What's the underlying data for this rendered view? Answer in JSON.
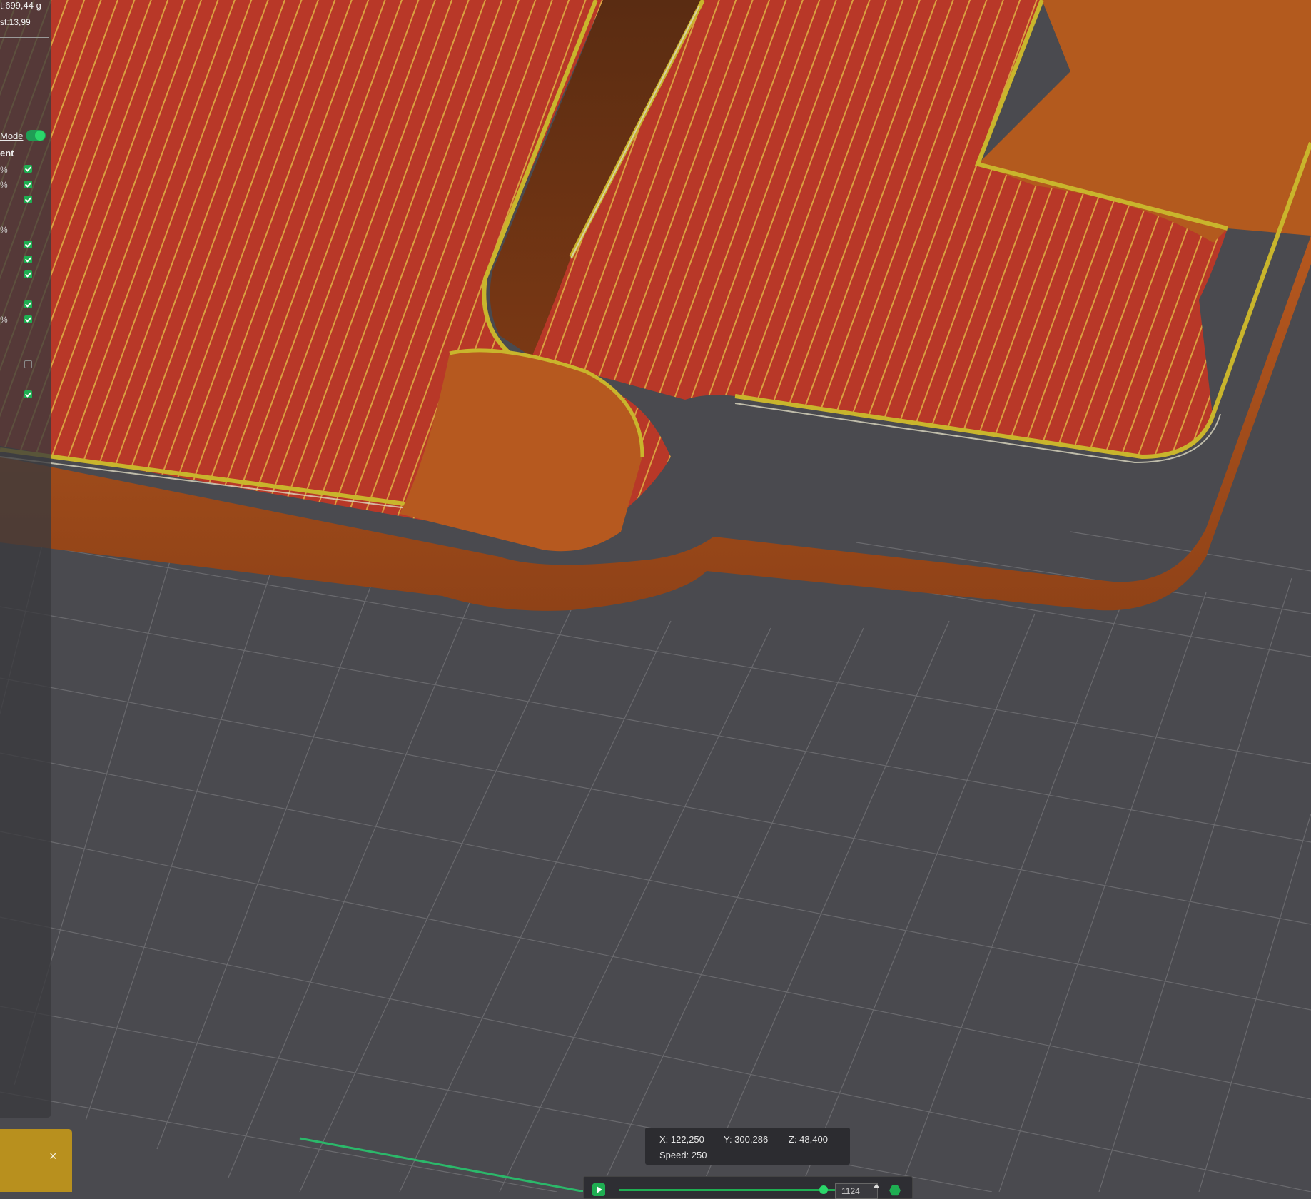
{
  "stats": {
    "weight": "t:699,44 g",
    "cost": "st:13,99"
  },
  "panel": {
    "mode_label": "Mode",
    "mode_enabled": true,
    "header": "ent",
    "rows": [
      {
        "pct": "%",
        "checked": true
      },
      {
        "pct": "%",
        "checked": true
      },
      {
        "pct": "",
        "checked": true
      },
      {
        "pct": "%",
        "checked": null
      },
      {
        "pct": "",
        "checked": true
      },
      {
        "pct": "",
        "checked": true
      },
      {
        "pct": "",
        "checked": true
      },
      {
        "pct": "",
        "checked": true
      },
      {
        "pct": "%",
        "checked": true
      },
      {
        "pct": "",
        "checked": false
      },
      {
        "pct": "",
        "checked": true
      }
    ]
  },
  "notification": {
    "close_label": "×",
    "color": "#b8901e"
  },
  "coords": {
    "x": "X: 122,250",
    "y": "Y: 300,286",
    "z": "Z: 48,400",
    "speed": "Speed: 250"
  },
  "layer_slider": {
    "move_value": "1124",
    "accent_color": "#1fae52"
  },
  "colors": {
    "top_surface": "#b83828",
    "wall": "#a8521f",
    "perimeter": "#c9b52c",
    "bed": "#4a4a4f"
  },
  "icons": [
    "play-icon",
    "checkbox-icon",
    "toggle-icon",
    "close-icon",
    "settings-hex-icon",
    "spin-up-icon"
  ]
}
